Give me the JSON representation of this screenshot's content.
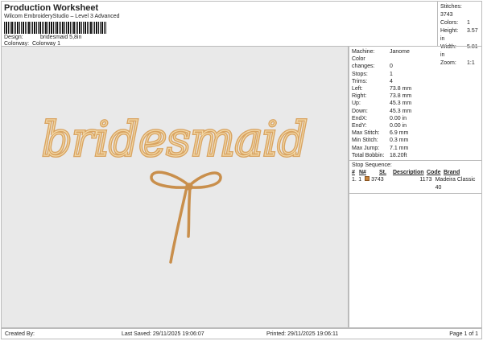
{
  "header": {
    "title": "Production Worksheet",
    "subtitle": "Wilcom EmbroideryStudio – Level 3 Advanced",
    "design_label": "Design:",
    "design_value": "bridesmaid 5,8in",
    "colorway_label": "Colorway:",
    "colorway_value": "Colorway 1"
  },
  "stats": [
    {
      "label": "Stitches:",
      "value": "3743"
    },
    {
      "label": "Colors:",
      "value": "1"
    },
    {
      "label": "Height:",
      "value": "3.57 in"
    },
    {
      "label": "Width:",
      "value": "5.81 in"
    },
    {
      "label": "Zoom:",
      "value": "1:1"
    }
  ],
  "info": [
    {
      "label": "Machine:",
      "value": "Janome"
    },
    {
      "label": "Color changes:",
      "value": "0"
    },
    {
      "label": "Stops:",
      "value": "1"
    },
    {
      "label": "Trims:",
      "value": "4"
    },
    {
      "label": "Left:",
      "value": "73.8 mm"
    },
    {
      "label": "Right:",
      "value": "73.8 mm"
    },
    {
      "label": "Up:",
      "value": "45.3 mm"
    },
    {
      "label": "Down:",
      "value": "45.3 mm"
    },
    {
      "label": "EndX:",
      "value": "0.00 in"
    },
    {
      "label": "EndY:",
      "value": "0.00 in"
    },
    {
      "label": "Max Stitch:",
      "value": "6.9 mm"
    },
    {
      "label": "Min Stitch:",
      "value": "0.3 mm"
    },
    {
      "label": "Max Jump:",
      "value": "7.1 mm"
    },
    {
      "label": "Total Bobbin:",
      "value": "18.20ft"
    }
  ],
  "stop_sequence": {
    "title": "Stop Sequence:",
    "headers": [
      "#",
      "N#",
      "St.",
      "Description",
      "Code",
      "Brand"
    ],
    "rows": [
      {
        "num": "1.",
        "n": "1",
        "color": "#c8843c",
        "st": "3743",
        "description": "",
        "code": "1173",
        "brand": "Madeira Classic 40"
      }
    ]
  },
  "design": {
    "text": "bridesmaid",
    "thread_color": "#d9a462"
  },
  "footer": {
    "created": "Created By:",
    "saved": "Last Saved: 29/11/2025 19:06:07",
    "printed": "Printed: 29/11/2025 19:06:11",
    "page": "Page 1 of 1"
  }
}
